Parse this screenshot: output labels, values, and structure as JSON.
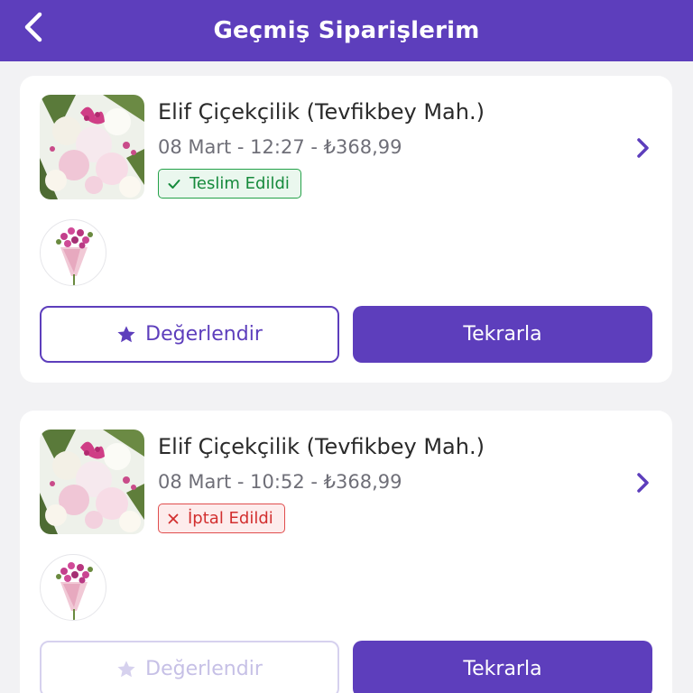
{
  "header": {
    "title": "Geçmiş Siparişlerim",
    "back_icon": "chevron-left-icon"
  },
  "colors": {
    "brand": "#5d3ebc",
    "delivered": "#168a3c",
    "cancelled": "#d22f2f"
  },
  "orders": [
    {
      "vendor": "Elif Çiçekçilik (Tevfikbey Mah.)",
      "meta": "08 Mart - 12:27 - ₺368,99",
      "status": "Teslim Edildi",
      "status_icon": "check-icon",
      "rate_label": "Değerlendir",
      "rate_enabled": true,
      "repeat_label": "Tekrarla"
    },
    {
      "vendor": "Elif Çiçekçilik (Tevfikbey Mah.)",
      "meta": "08 Mart - 10:52 - ₺368,99",
      "status": "İptal Edildi",
      "status_icon": "x-icon",
      "rate_label": "Değerlendir",
      "rate_enabled": false,
      "repeat_label": "Tekrarla"
    }
  ]
}
